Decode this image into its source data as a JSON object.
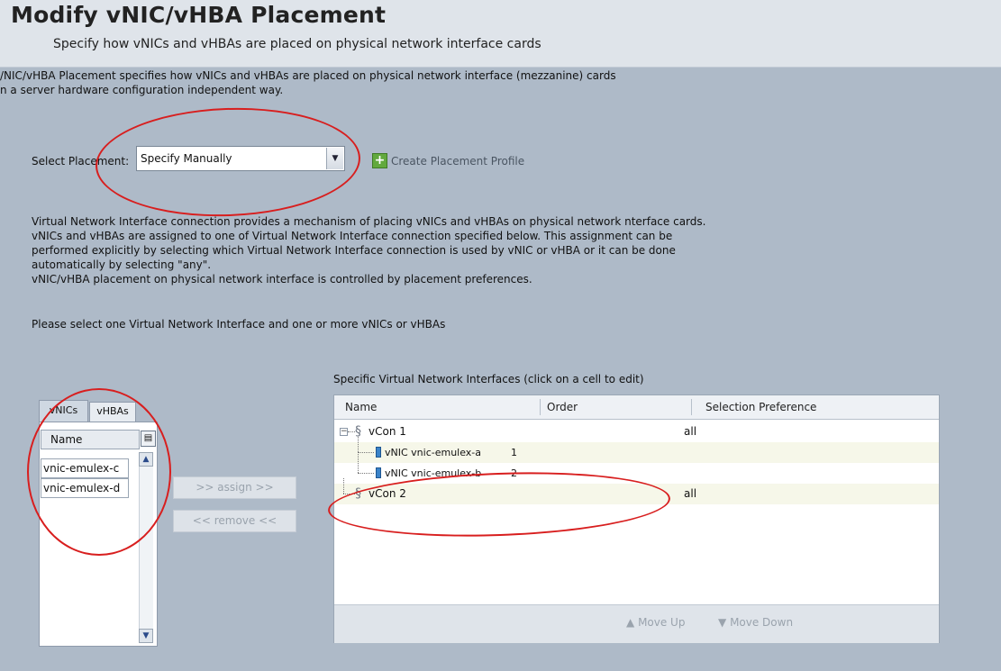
{
  "header": {
    "title": "Modify vNIC/vHBA Placement",
    "subtitle": "Specify how vNICs and vHBAs are placed on physical network interface cards"
  },
  "intro": {
    "line1": "/NIC/vHBA Placement specifies how vNICs and vHBAs are placed on physical network interface (mezzanine) cards",
    "line2": "n a server hardware configuration independent way."
  },
  "placement": {
    "label": "Select Placement:",
    "selected": "Specify Manually",
    "create_profile_label": "Create Placement Profile"
  },
  "description": [
    "Virtual Network Interface connection provides a mechanism of placing vNICs and vHBAs on physical network nterface cards.",
    "vNICs and vHBAs are assigned to one of Virtual Network Interface connection specified below. This assignment can be",
    "performed explicitly by selecting which Virtual Network Interface connection is used by vNIC or vHBA or it can be done",
    "automatically by selecting \"any\".",
    "vNIC/vHBA placement on physical network interface is controlled by placement preferences."
  ],
  "instruction": "Please select one Virtual Network Interface and one or more vNICs or vHBAs",
  "left_panel": {
    "tabs": [
      "vNICs",
      "vHBAs"
    ],
    "column_header": "Name",
    "items": [
      "vnic-emulex-c",
      "vnic-emulex-d"
    ]
  },
  "buttons": {
    "assign": ">> assign >>",
    "remove": "<< remove <<"
  },
  "vnic_table": {
    "caption": "Specific Virtual Network Interfaces (click on a cell to edit)",
    "columns": [
      "Name",
      "Order",
      "Selection Preference"
    ],
    "rows": [
      {
        "name": "vCon 1",
        "order": "",
        "preference": "all"
      },
      {
        "name": "vNIC vnic-emulex-a",
        "order": "1",
        "preference": ""
      },
      {
        "name": "vNIC vnic-emulex-b",
        "order": "2",
        "preference": ""
      },
      {
        "name": "vCon 2",
        "order": "",
        "preference": "all"
      }
    ],
    "move_up": "Move Up",
    "move_down": "Move Down"
  },
  "colors": {
    "background": "#aebac8",
    "header_bg": "#dfe4ea",
    "annotation_red": "#d81e1e",
    "add_icon_green": "#62a93d",
    "nic_icon_blue": "#3a83c9"
  },
  "icons": [
    "add-icon",
    "dropdown-arrow-icon",
    "column-chooser-icon",
    "vcon-icon",
    "vnic-icon",
    "tree-collapse-icon",
    "arrow-up-icon",
    "arrow-down-icon"
  ]
}
